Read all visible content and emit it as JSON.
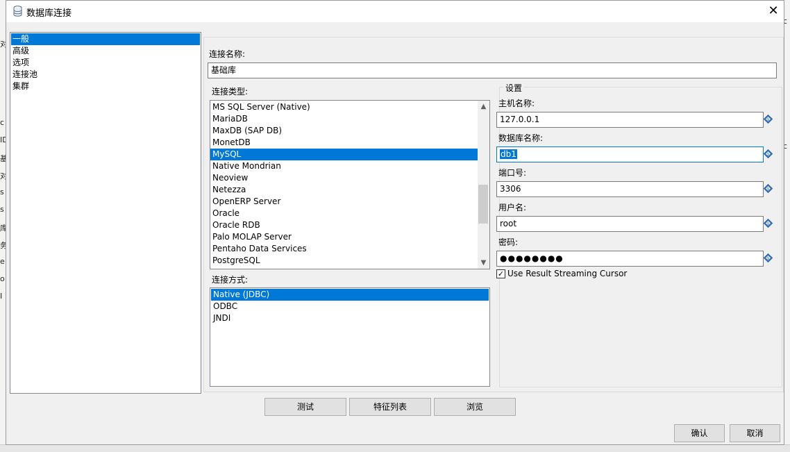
{
  "background": {
    "left_fragments": [
      "对",
      "c",
      "ID",
      "基",
      "对",
      "s",
      "s",
      "库",
      "务",
      "e",
      "o",
      "I"
    ],
    "right_fragments": [
      "c",
      "c"
    ]
  },
  "dialog": {
    "title": "数据库连接",
    "icon": "database-icon",
    "close_label": "✕"
  },
  "nav": {
    "items": [
      {
        "label": "一般",
        "selected": true
      },
      {
        "label": "高级",
        "selected": false
      },
      {
        "label": "选项",
        "selected": false
      },
      {
        "label": "连接池",
        "selected": false
      },
      {
        "label": "集群",
        "selected": false
      }
    ]
  },
  "general": {
    "connection_name_label": "连接名称:",
    "connection_name_value": "基础库",
    "connection_type_label": "连接类型:",
    "connection_types": [
      {
        "label": "MS SQL Server (Native)",
        "selected": false
      },
      {
        "label": "MariaDB",
        "selected": false
      },
      {
        "label": "MaxDB (SAP DB)",
        "selected": false
      },
      {
        "label": "MonetDB",
        "selected": false
      },
      {
        "label": "MySQL",
        "selected": true
      },
      {
        "label": "Native Mondrian",
        "selected": false
      },
      {
        "label": "Neoview",
        "selected": false
      },
      {
        "label": "Netezza",
        "selected": false
      },
      {
        "label": "OpenERP Server",
        "selected": false
      },
      {
        "label": "Oracle",
        "selected": false
      },
      {
        "label": "Oracle RDB",
        "selected": false
      },
      {
        "label": "Palo MOLAP Server",
        "selected": false
      },
      {
        "label": "Pentaho Data Services",
        "selected": false
      },
      {
        "label": "PostgreSQL",
        "selected": false
      }
    ],
    "access_label": "连接方式:",
    "access_methods": [
      {
        "label": "Native (JDBC)",
        "selected": true
      },
      {
        "label": "ODBC",
        "selected": false
      },
      {
        "label": "JNDI",
        "selected": false
      }
    ]
  },
  "settings": {
    "group_title": "设置",
    "host_label": "主机名称:",
    "host_value": "127.0.0.1",
    "db_label": "数据库名称:",
    "db_value": "db1",
    "port_label": "端口号:",
    "port_value": "3306",
    "user_label": "用户名:",
    "user_value": "root",
    "password_label": "密码:",
    "password_value": "●●●●●●●●",
    "streaming_label": "Use Result Streaming Cursor",
    "streaming_checked": true,
    "variable_icon": "variable-diamond-icon"
  },
  "buttons": {
    "test": "测试",
    "features": "特征列表",
    "explore": "浏览",
    "ok": "确认",
    "cancel": "取消"
  }
}
